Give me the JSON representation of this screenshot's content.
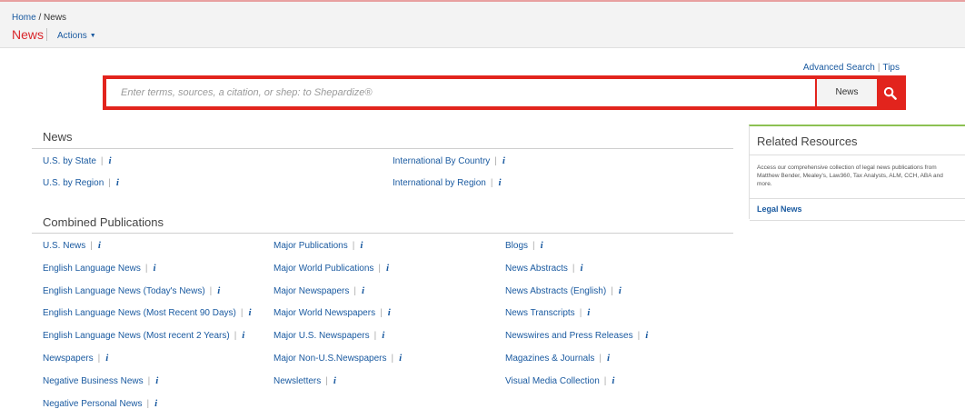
{
  "breadcrumb": {
    "home": "Home",
    "separator": "/",
    "current": "News"
  },
  "page_title": "News",
  "actions_label": "Actions",
  "links": {
    "advanced_search": "Advanced Search",
    "tips": "Tips"
  },
  "search": {
    "placeholder": "Enter terms, sources, a citation, or shep: to Shepardize®",
    "source_label": "News"
  },
  "news_section": {
    "title": "News",
    "items": [
      {
        "label": "U.S. by State"
      },
      {
        "label": "U.S. by Region"
      },
      {
        "label": "International By Country"
      },
      {
        "label": "International by Region"
      }
    ]
  },
  "combined_section": {
    "title": "Combined Publications",
    "col1": [
      {
        "label": "U.S. News"
      },
      {
        "label": "English Language News"
      },
      {
        "label": "English Language News (Today's News)"
      },
      {
        "label": "English Language News (Most Recent 90 Days)"
      },
      {
        "label": "English Language News (Most recent 2 Years)"
      },
      {
        "label": "Newspapers"
      },
      {
        "label": "Negative Business News"
      },
      {
        "label": "Negative Personal News"
      }
    ],
    "col2": [
      {
        "label": "Major Publications"
      },
      {
        "label": "Major World Publications"
      },
      {
        "label": "Major Newspapers"
      },
      {
        "label": "Major World Newspapers"
      },
      {
        "label": "Major U.S. Newspapers"
      },
      {
        "label": "Major Non-U.S.Newspapers"
      },
      {
        "label": "Newsletters"
      }
    ],
    "col3": [
      {
        "label": "Blogs"
      },
      {
        "label": "News Abstracts"
      },
      {
        "label": "News Abstracts (English)"
      },
      {
        "label": "News Transcripts"
      },
      {
        "label": "Newswires and Press Releases"
      },
      {
        "label": "Magazines & Journals"
      },
      {
        "label": "Visual Media Collection"
      }
    ]
  },
  "info_glyph": "i",
  "separator_glyph": "|",
  "related_resources": {
    "title": "Related Resources",
    "description": "Access our comprehensive collection of legal news publications from Matthew Bender, Mealey's, Law360, Tax Analysts, ALM, CCH, ABA and more.",
    "link": "Legal News"
  },
  "colors": {
    "accent_red": "#e2241d",
    "link_blue": "#1a5aa0",
    "green_accent": "#8cc152"
  },
  "icons": {
    "search": "magnifier-icon",
    "info": "info-icon",
    "dropdown": "caret-down-icon"
  }
}
